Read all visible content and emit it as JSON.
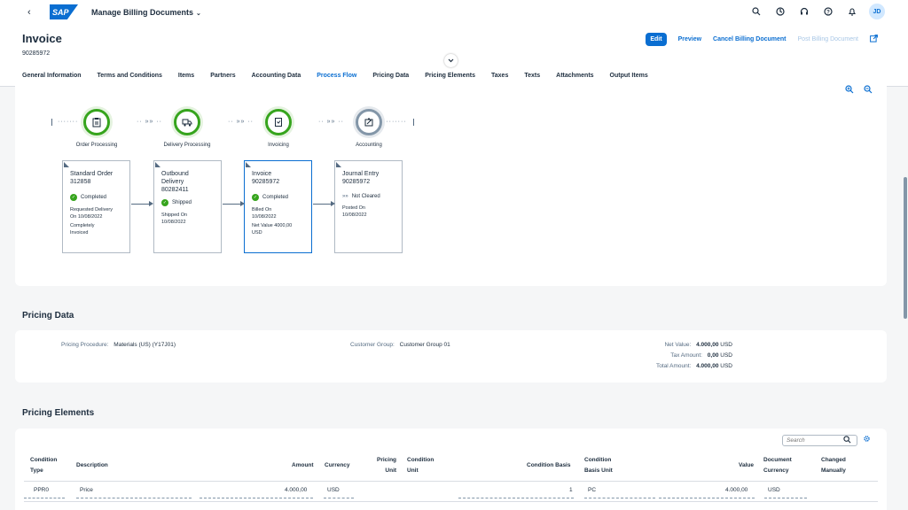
{
  "shell": {
    "back": "‹",
    "logo": "SAP",
    "app_title": "Manage Billing Documents",
    "app_chevron": "⌄",
    "avatar": "JD"
  },
  "header": {
    "title": "Invoice",
    "subtitle": "90285972",
    "actions": {
      "edit": "Edit",
      "preview": "Preview",
      "cancel": "Cancel Billing Document",
      "post": "Post Billing Document"
    }
  },
  "tabs": [
    {
      "label": "General Information"
    },
    {
      "label": "Terms and Conditions"
    },
    {
      "label": "Items"
    },
    {
      "label": "Partners"
    },
    {
      "label": "Accounting Data"
    },
    {
      "label": "Process Flow",
      "active": true
    },
    {
      "label": "Pricing Data"
    },
    {
      "label": "Pricing Elements"
    },
    {
      "label": "Taxes"
    },
    {
      "label": "Texts"
    },
    {
      "label": "Attachments"
    },
    {
      "label": "Output Items"
    }
  ],
  "process_flow": {
    "lanes": [
      {
        "label": "Order Processing",
        "icon": "clipboard-icon",
        "state": "done"
      },
      {
        "label": "Delivery Processing",
        "icon": "truck-icon",
        "state": "done"
      },
      {
        "label": "Invoicing",
        "icon": "invoice-icon",
        "state": "done"
      },
      {
        "label": "Accounting",
        "icon": "accounting-icon",
        "state": "pending"
      }
    ],
    "nodes": [
      {
        "title": "Standard Order",
        "number": "312858",
        "status": "Completed",
        "info1": "Requested Delivery",
        "info2": "On 10/08/2022",
        "info3": "Completely",
        "info4": "Invoiced"
      },
      {
        "title": "Outbound",
        "title2": "Delivery",
        "number": "80282411",
        "status": "Shipped",
        "info1": "Shipped On",
        "info2": "10/08/2022"
      },
      {
        "title": "Invoice",
        "number": "90285972",
        "status": "Completed",
        "info1": "Billed On",
        "info2": "10/08/2022",
        "info3": "Net Value 4000,00",
        "info4": "USD"
      },
      {
        "title": "Journal Entry",
        "number": "90285972",
        "status": "Not Cleared",
        "info1": "Posted On",
        "info2": "10/08/2022"
      }
    ]
  },
  "pricing_data": {
    "title": "Pricing Data",
    "procedure_label": "Pricing Procedure:",
    "procedure_value": "Materials (US) (Y17J01)",
    "customer_group_label": "Customer Group:",
    "customer_group_value": "Customer Group 01",
    "net_value_label": "Net Value:",
    "net_value": "4.000,00",
    "tax_amount_label": "Tax Amount:",
    "tax_amount": "0,00",
    "total_amount_label": "Total Amount:",
    "total_amount": "4.000,00",
    "currency": "USD"
  },
  "pricing_elements": {
    "title": "Pricing Elements",
    "search_placeholder": "Search",
    "columns": {
      "condition_type_1": "Condition",
      "condition_type_2": "Type",
      "description": "Description",
      "amount": "Amount",
      "currency": "Currency",
      "pricing_unit_1": "Pricing",
      "pricing_unit_2": "Unit",
      "condition_unit_1": "Condition",
      "condition_unit_2": "Unit",
      "condition_basis": "Condition Basis",
      "condition_basis_unit_1": "Condition",
      "condition_basis_unit_2": "Basis Unit",
      "value": "Value",
      "document_currency_1": "Document",
      "document_currency_2": "Currency",
      "changed_manually_1": "Changed",
      "changed_manually_2": "Manually"
    },
    "rows": [
      {
        "type": "PPR0",
        "description": "Price",
        "amount": "4.000,00",
        "currency": "USD",
        "pricing_unit": "",
        "condition_unit": "",
        "basis": "1",
        "basis_unit": "PC",
        "value": "4.000,00",
        "doc_currency": "USD"
      }
    ]
  }
}
